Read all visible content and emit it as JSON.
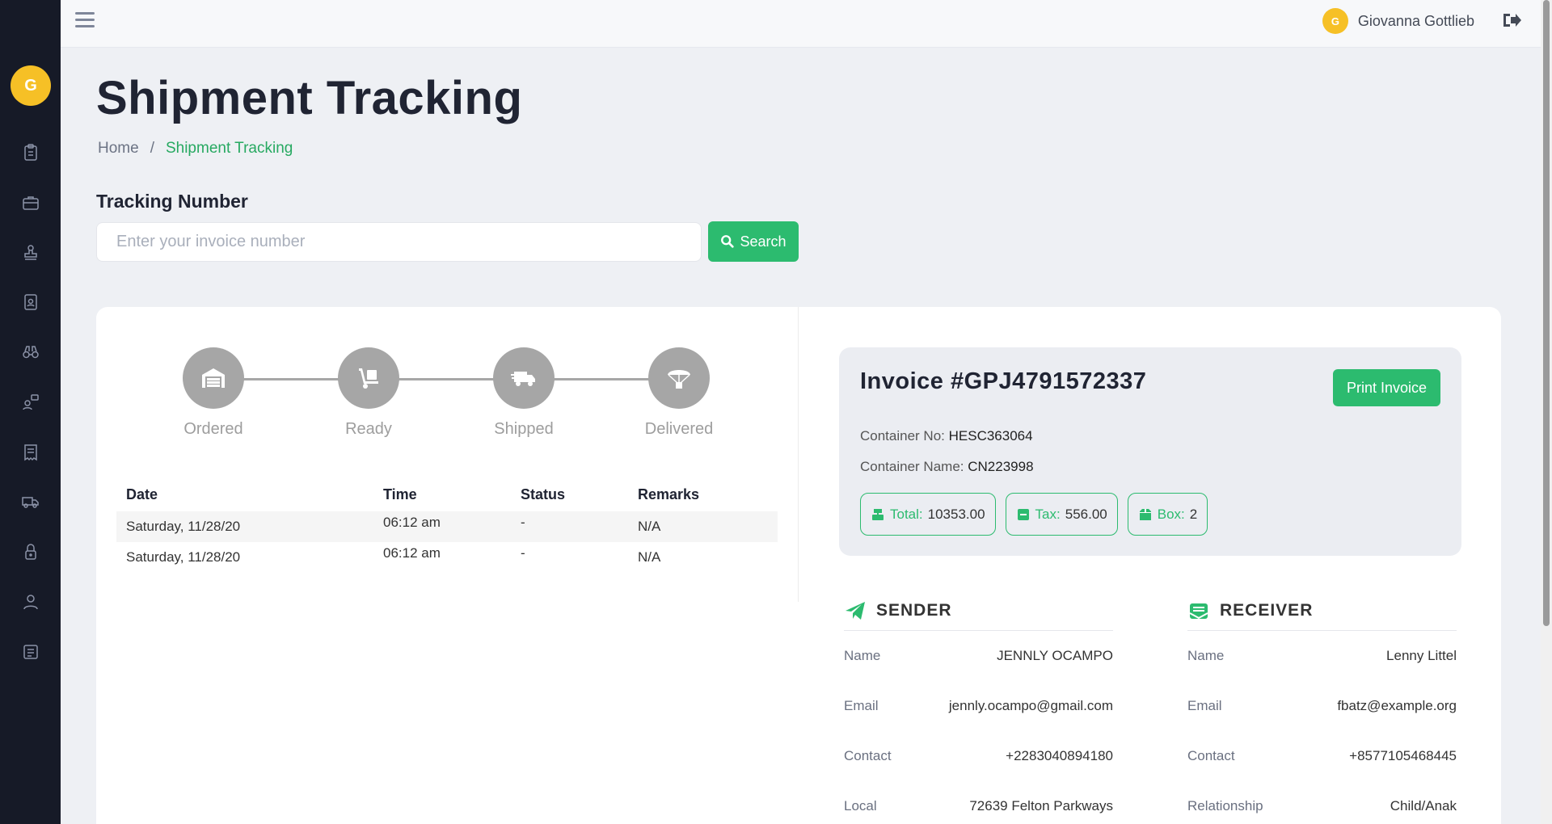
{
  "sidebar": {
    "avatar_initial": "G",
    "icons": [
      "clipboard-icon",
      "briefcase-icon",
      "stamp-icon",
      "id-badge-icon",
      "binoculars-icon",
      "user-chat-icon",
      "receipt-icon",
      "truck-icon",
      "lock-icon",
      "user-icon",
      "newspaper-icon"
    ]
  },
  "topbar": {
    "user_initial": "G",
    "user_name": "Giovanna Gottlieb"
  },
  "page": {
    "title": "Shipment Tracking",
    "breadcrumb": {
      "home": "Home",
      "separator": "/",
      "current": "Shipment Tracking"
    }
  },
  "tracking": {
    "label": "Tracking Number",
    "placeholder": "Enter your invoice number",
    "value": "",
    "search_label": "Search"
  },
  "steps": [
    {
      "label": "Ordered",
      "icon": "warehouse-icon"
    },
    {
      "label": "Ready",
      "icon": "dolly-icon"
    },
    {
      "label": "Shipped",
      "icon": "shipping-truck-icon"
    },
    {
      "label": "Delivered",
      "icon": "parachute-box-icon"
    }
  ],
  "history": {
    "headers": [
      "Date",
      "Time",
      "Status",
      "Remarks"
    ],
    "rows": [
      {
        "date": "Saturday, 11/28/20",
        "time": "06:12 am",
        "status": "-",
        "remarks": "N/A"
      },
      {
        "date": "Saturday, 11/28/20",
        "time": "06:12 am",
        "status": "-",
        "remarks": "N/A"
      }
    ]
  },
  "invoice": {
    "title": "Invoice #GPJ4791572337",
    "print_label": "Print Invoice",
    "container_no_label": "Container No:",
    "container_no": "HESC363064",
    "container_name_label": "Container Name:",
    "container_name": "CN223998",
    "total_label": "Total:",
    "total": "10353.00",
    "tax_label": "Tax:",
    "tax": "556.00",
    "box_label": "Box:",
    "box": "2"
  },
  "sender": {
    "title": "SENDER",
    "rows": [
      {
        "key": "Name",
        "value": "JENNLY OCAMPO"
      },
      {
        "key": "Email",
        "value": "jennly.ocampo@gmail.com"
      },
      {
        "key": "Contact",
        "value": "+2283040894180"
      },
      {
        "key": "Local",
        "value": "72639 Felton Parkways"
      }
    ]
  },
  "receiver": {
    "title": "RECEIVER",
    "rows": [
      {
        "key": "Name",
        "value": "Lenny Littel"
      },
      {
        "key": "Email",
        "value": "fbatz@example.org"
      },
      {
        "key": "Contact",
        "value": "+8577105468445"
      },
      {
        "key": "Relationship",
        "value": "Child/Anak"
      }
    ]
  },
  "colors": {
    "accent": "#2cbb6f",
    "sidebar_bg": "#161a27",
    "avatar": "#f6c026",
    "step_gray": "#a6a6a6"
  }
}
